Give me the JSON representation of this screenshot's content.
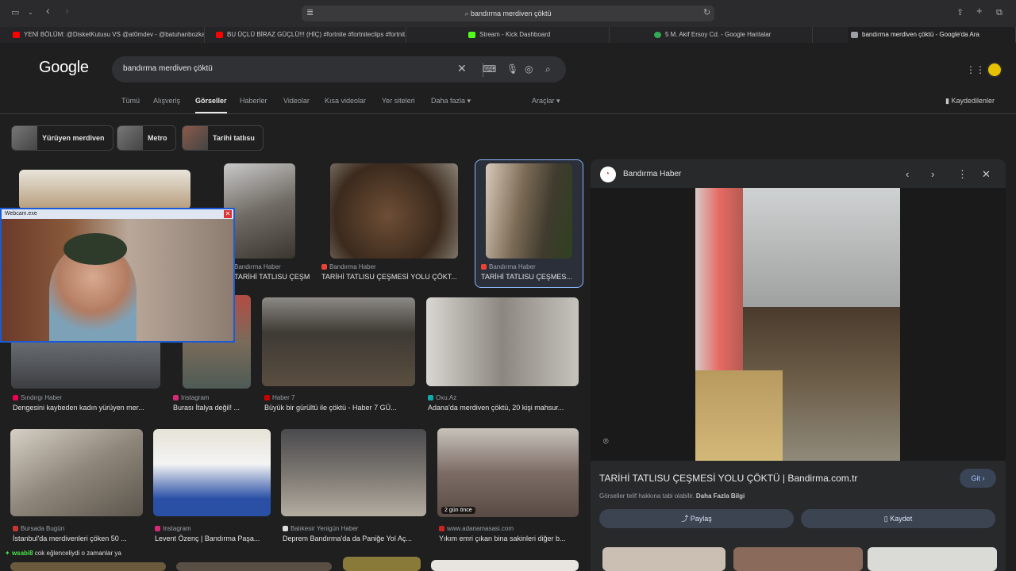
{
  "browser": {
    "url": "bandırma merdiven çöktü",
    "tabs": [
      {
        "label": "YENİ BÖLÜM: @DisketKutusu VS @at0mdev - @batuhanbozka...",
        "color": "#ff0000"
      },
      {
        "label": "BU ÜÇLÜ BİRAZ GÜÇLÜ!!! (HİÇ) #fortnite #fortniteclips #fortnit...",
        "color": "#ff0000"
      },
      {
        "label": "Stream - Kick Dashboard",
        "color": "#53fc18"
      },
      {
        "label": "5 M. Akif Ersoy Cd. - Google Haritalar",
        "color": "#34a853"
      },
      {
        "label": "bandırma merdiven çöktü - Google'da Ara",
        "color": "#9aa0a6"
      }
    ]
  },
  "google": {
    "logo": "Google",
    "query": "bandırma merdiven çöktü",
    "nav": [
      "Tümü",
      "Alışveriş",
      "Görseller",
      "Haberler",
      "Videolar",
      "Kısa videolar",
      "Yer siteleri",
      "Daha fazla"
    ],
    "tools": "Araçlar",
    "saved": "Kaydedilenler",
    "chips": [
      "Yürüyen merdiven",
      "Metro",
      "Tarihi tatlısu"
    ]
  },
  "results": [
    {
      "source": "Bandırma Haber",
      "caption": "TARİHİ TATLISU ÇEŞMES...",
      "icon": "#ea4335"
    },
    {
      "source": "Bandırma Haber",
      "caption": "TARİHİ TATLISU ÇEŞMESİ YOLU ÇÖKT...",
      "icon": "#ea4335"
    },
    {
      "source": "Bandırma Haber",
      "caption": "TARİHİ TATLISU ÇEŞMES...",
      "icon": "#ea4335"
    },
    {
      "source": "Sındırgı Haber",
      "caption": "Dengesini kaybeden kadın yürüyen mer...",
      "icon": "#e05"
    },
    {
      "source": "Instagram",
      "caption": "Burası İtalya değil! ...",
      "icon": "#d62976"
    },
    {
      "source": "Haber 7",
      "caption": "Büyük bir gürültü ile çöktü - Haber 7 GÜ...",
      "icon": "#c00"
    },
    {
      "source": "Oxu.Az",
      "caption": "Adana'da merdiven çöktü, 20 kişi mahsur...",
      "icon": "#1aa"
    },
    {
      "source": "Bursada Bugün",
      "caption": "İstanbul'da merdivenleri çöken 50 ...",
      "icon": "#c33"
    },
    {
      "source": "Instagram",
      "caption": "Levent Özenç | Bandırma Paşa...",
      "icon": "#d62976"
    },
    {
      "source": "Balıkesir Yenigün Haber",
      "caption": "Deprem Bandırma'da da Paniğe Yol Aç...",
      "icon": "#ddd"
    },
    {
      "source": "www.adanamasasi.com",
      "caption": "Yıkım emri çıkan bina sakinleri diğer b...",
      "icon": "#c22"
    }
  ],
  "badge_age": "2 gün önce",
  "panel": {
    "source": "Bandırma Haber",
    "title": "TARİHİ TATLISU ÇEŞMESİ YOLU ÇÖKTÜ | Bandirma.com.tr",
    "note": "Görseller telif hakkına tabi olabilir.",
    "note_link": "Daha Fazla Bilgi",
    "go": "Git",
    "share": "Paylaş",
    "save": "Kaydet"
  },
  "webcam": {
    "title": "Webcam.exe"
  },
  "chat": {
    "user": "wsabi8",
    "message": "cok eğlenceliydi o zamanlar ya"
  }
}
